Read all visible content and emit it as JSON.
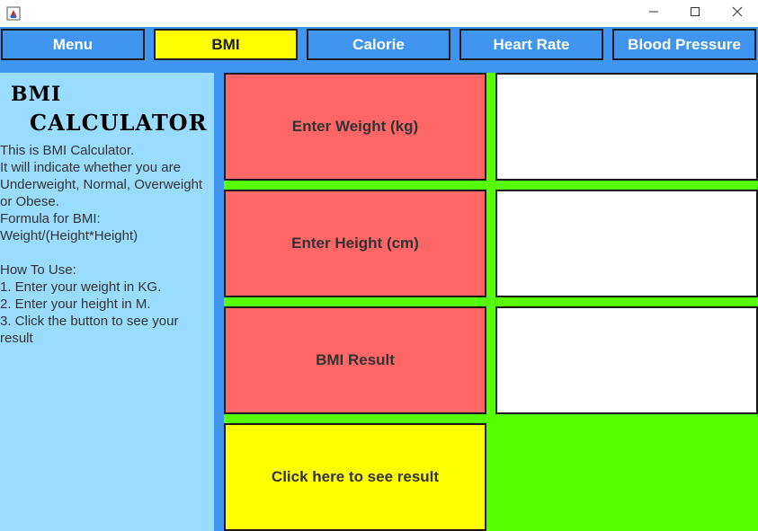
{
  "window": {
    "minimize_icon": "minimize-icon",
    "maximize_icon": "maximize-icon",
    "close_icon": "close-icon"
  },
  "nav": {
    "items": [
      {
        "label": "Menu"
      },
      {
        "label": "BMI",
        "active": true
      },
      {
        "label": "Calorie"
      },
      {
        "label": "Heart Rate"
      },
      {
        "label": "Blood Pressure"
      }
    ]
  },
  "sidebar": {
    "title_line1": "BMI",
    "title_line2": "CALCULATOR",
    "description": "This is BMI Calculator.\nIt will indicate whether you are Underweight, Normal, Overweight or Obese.\nFormula for BMI:\nWeight/(Height*Height)\n\nHow To Use:\n1. Enter your weight in KG.\n2. Enter your height in M.\n3. Click the button to see your result"
  },
  "form": {
    "weight_label": "Enter Weight (kg)",
    "weight_value": "",
    "height_label": "Enter Height (cm)",
    "height_value": "",
    "result_label": "BMI Result",
    "result_value": "",
    "submit_label": "Click here to see result"
  },
  "colors": {
    "nav_blue": "#3f95f0",
    "active_yellow": "#ffff00",
    "sidebar_blue": "#99dcff",
    "label_red": "#ff6666",
    "grid_green": "#55ff00"
  }
}
